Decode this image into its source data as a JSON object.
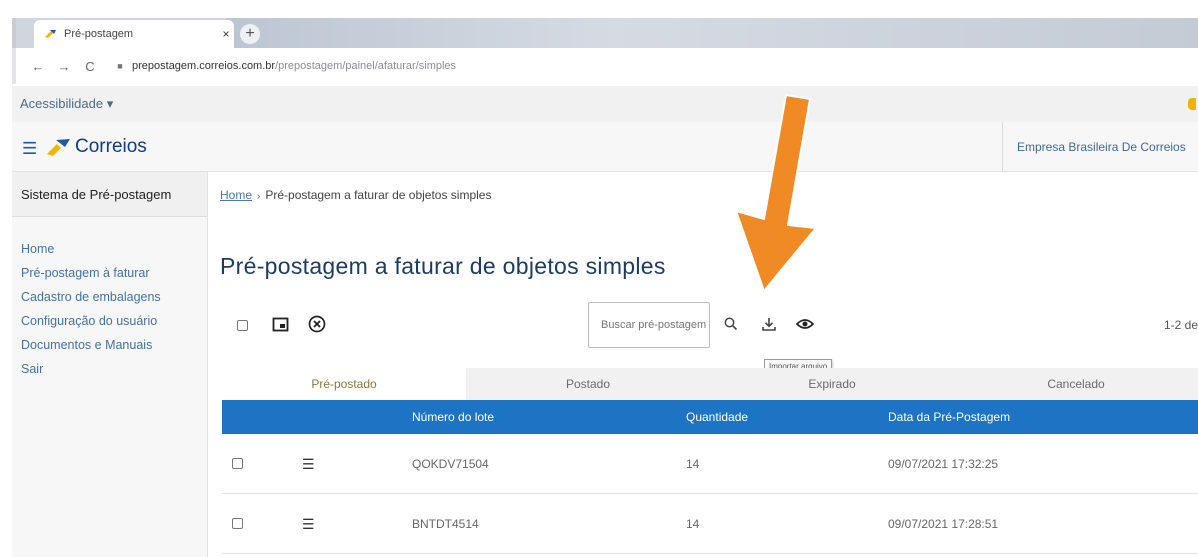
{
  "browser": {
    "tab_title": "Pré-postagem",
    "tab_close": "×",
    "new_tab": "+",
    "url_host": "prepostagem.correios.com.br",
    "url_path": "/prepostagem/painel/afaturar/simples"
  },
  "accessibility": {
    "label": "Acessibilidade ▾"
  },
  "header": {
    "brand": "Correios",
    "company": "Empresa Brasileira De Correios"
  },
  "sidebar": {
    "title": "Sistema de Pré-postagem",
    "items": [
      {
        "label": "Home"
      },
      {
        "label": "Pré-postagem à faturar"
      },
      {
        "label": "Cadastro de embalagens"
      },
      {
        "label": "Configuração do usuário"
      },
      {
        "label": "Documentos e Manuais"
      },
      {
        "label": "Sair"
      }
    ]
  },
  "breadcrumb": {
    "home": "Home",
    "sep": "›",
    "current": "Pré-postagem a faturar de objetos simples"
  },
  "page": {
    "title": "Pré-postagem a faturar de objetos simples"
  },
  "toolbar": {
    "search_placeholder": "Buscar pré-postagem",
    "pager": "1-2 de",
    "tooltip": "Importar arquivo"
  },
  "tabs": [
    {
      "label": "Pré-postado",
      "active": true
    },
    {
      "label": "Postado",
      "active": false
    },
    {
      "label": "Expirado",
      "active": false
    },
    {
      "label": "Cancelado",
      "active": false
    }
  ],
  "table": {
    "headers": {
      "lote": "Número do lote",
      "quantidade": "Quantidade",
      "data": "Data da Pré-Postagem"
    },
    "rows": [
      {
        "lote": "QOKDV71504",
        "quantidade": "14",
        "data": "09/07/2021 17:32:25"
      },
      {
        "lote": "BNTDT4514",
        "quantidade": "14",
        "data": "09/07/2021 17:28:51"
      }
    ]
  },
  "colors": {
    "table_header": "#1d74c4",
    "arrow": "#f08a24",
    "title": "#1c3c60",
    "link": "#3f74a6"
  }
}
